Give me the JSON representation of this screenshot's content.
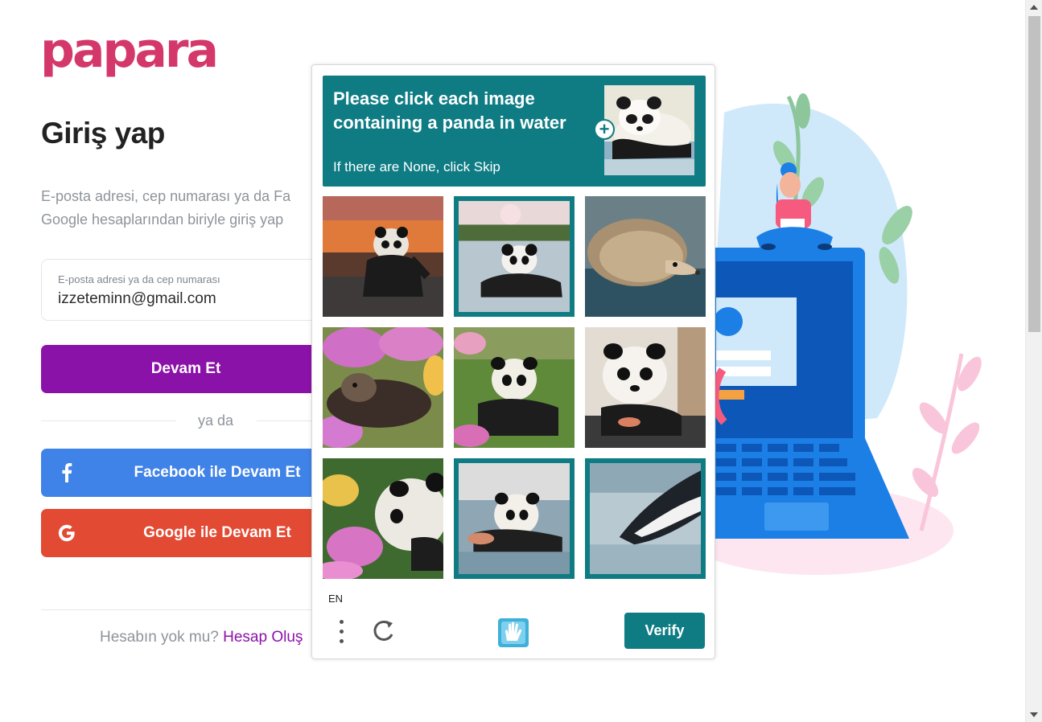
{
  "brand": {
    "logo_text": "papara"
  },
  "login": {
    "title": "Giriş yap",
    "description_line1": "E-posta adresi, cep numarası ya da Fa",
    "description_line2": "Google hesaplarından biriyle giriş yap",
    "email_label": "E-posta adresi ya da cep numarası",
    "email_value": "izzeteminn@gmail.com",
    "continue_label": "Devam Et",
    "divider_text": "ya da",
    "facebook_label": "Facebook ile Devam Et",
    "google_label": "Google ile Devam Et",
    "signup_prompt": "Hesabın yok mu?",
    "signup_link": "Hesap Oluş"
  },
  "captcha": {
    "prompt_title": "Please click each image containing a panda in water",
    "prompt_sub": "If there are None, click Skip",
    "language": "EN",
    "verify_label": "Verify",
    "tiles": [
      {
        "subject": "panda-in-water-sunset",
        "selected": false
      },
      {
        "subject": "panda-in-water-lake",
        "selected": true
      },
      {
        "subject": "hedgehog-in-water",
        "selected": false
      },
      {
        "subject": "otter-in-flowers",
        "selected": false
      },
      {
        "subject": "panda-on-grass",
        "selected": false
      },
      {
        "subject": "panda-indoors",
        "selected": false
      },
      {
        "subject": "panda-in-flowers",
        "selected": false
      },
      {
        "subject": "panda-in-water-lying",
        "selected": true
      },
      {
        "subject": "panda-swimming",
        "selected": true
      }
    ]
  },
  "colors": {
    "brand_pink": "#d4386b",
    "continue_purple": "#8b12a8",
    "facebook_blue": "#3f82e8",
    "google_red": "#e34a33",
    "captcha_teal": "#0f7c84"
  }
}
